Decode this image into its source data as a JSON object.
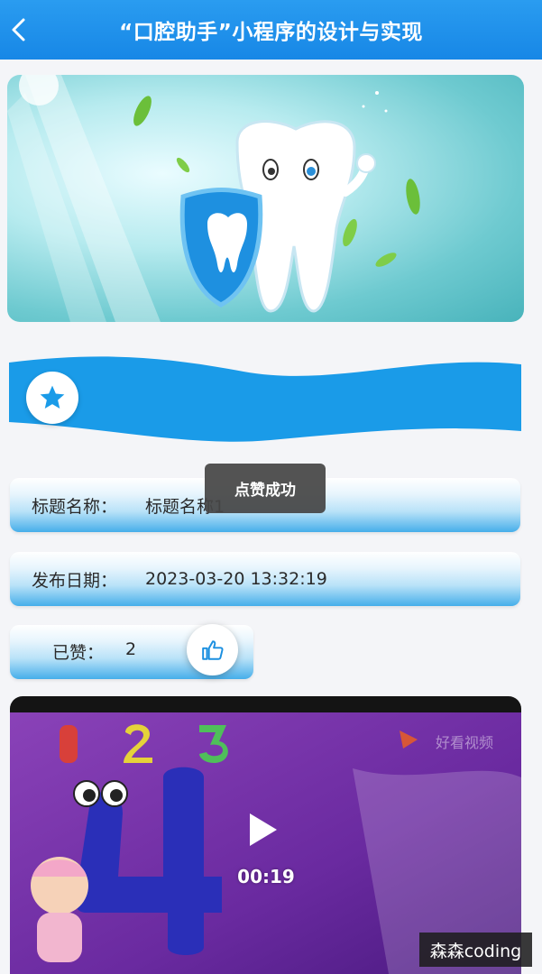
{
  "header": {
    "title": "“口腔助手”小程序的设计与实现",
    "back_icon": "chevron-left-icon"
  },
  "banner": {
    "illustration": "cartoon-tooth-with-shield"
  },
  "decoration": {
    "icon": "star-icon",
    "accent_color": "#1a9be8"
  },
  "details": {
    "title_label": "标题名称：",
    "title_value": "标题名称1",
    "date_label": "发布日期：",
    "date_value": "2023-03-20 13:32:19",
    "likes_label": "已赞：",
    "likes_value": "2",
    "like_icon": "thumbs-up-icon"
  },
  "toast": {
    "message": "点赞成功"
  },
  "video": {
    "current_time": "00:19",
    "watermark": "好看视频",
    "play_icon": "play-icon"
  },
  "overlay": {
    "label": "森森coding"
  },
  "colors": {
    "header": "#1b8ce8",
    "accent": "#1a9be8",
    "page_background": "#f4f5f8"
  }
}
